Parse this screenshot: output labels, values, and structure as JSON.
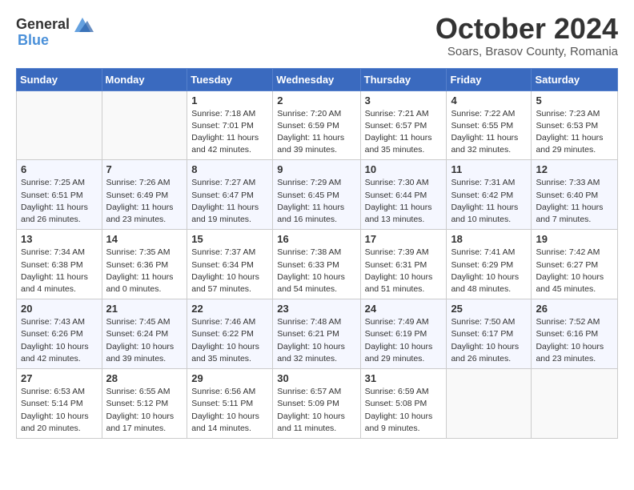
{
  "header": {
    "logo_general": "General",
    "logo_blue": "Blue",
    "month_title": "October 2024",
    "location": "Soars, Brasov County, Romania"
  },
  "weekdays": [
    "Sunday",
    "Monday",
    "Tuesday",
    "Wednesday",
    "Thursday",
    "Friday",
    "Saturday"
  ],
  "weeks": [
    [
      {
        "num": "",
        "detail": ""
      },
      {
        "num": "",
        "detail": ""
      },
      {
        "num": "1",
        "detail": "Sunrise: 7:18 AM\nSunset: 7:01 PM\nDaylight: 11 hours and 42 minutes."
      },
      {
        "num": "2",
        "detail": "Sunrise: 7:20 AM\nSunset: 6:59 PM\nDaylight: 11 hours and 39 minutes."
      },
      {
        "num": "3",
        "detail": "Sunrise: 7:21 AM\nSunset: 6:57 PM\nDaylight: 11 hours and 35 minutes."
      },
      {
        "num": "4",
        "detail": "Sunrise: 7:22 AM\nSunset: 6:55 PM\nDaylight: 11 hours and 32 minutes."
      },
      {
        "num": "5",
        "detail": "Sunrise: 7:23 AM\nSunset: 6:53 PM\nDaylight: 11 hours and 29 minutes."
      }
    ],
    [
      {
        "num": "6",
        "detail": "Sunrise: 7:25 AM\nSunset: 6:51 PM\nDaylight: 11 hours and 26 minutes."
      },
      {
        "num": "7",
        "detail": "Sunrise: 7:26 AM\nSunset: 6:49 PM\nDaylight: 11 hours and 23 minutes."
      },
      {
        "num": "8",
        "detail": "Sunrise: 7:27 AM\nSunset: 6:47 PM\nDaylight: 11 hours and 19 minutes."
      },
      {
        "num": "9",
        "detail": "Sunrise: 7:29 AM\nSunset: 6:45 PM\nDaylight: 11 hours and 16 minutes."
      },
      {
        "num": "10",
        "detail": "Sunrise: 7:30 AM\nSunset: 6:44 PM\nDaylight: 11 hours and 13 minutes."
      },
      {
        "num": "11",
        "detail": "Sunrise: 7:31 AM\nSunset: 6:42 PM\nDaylight: 11 hours and 10 minutes."
      },
      {
        "num": "12",
        "detail": "Sunrise: 7:33 AM\nSunset: 6:40 PM\nDaylight: 11 hours and 7 minutes."
      }
    ],
    [
      {
        "num": "13",
        "detail": "Sunrise: 7:34 AM\nSunset: 6:38 PM\nDaylight: 11 hours and 4 minutes."
      },
      {
        "num": "14",
        "detail": "Sunrise: 7:35 AM\nSunset: 6:36 PM\nDaylight: 11 hours and 0 minutes."
      },
      {
        "num": "15",
        "detail": "Sunrise: 7:37 AM\nSunset: 6:34 PM\nDaylight: 10 hours and 57 minutes."
      },
      {
        "num": "16",
        "detail": "Sunrise: 7:38 AM\nSunset: 6:33 PM\nDaylight: 10 hours and 54 minutes."
      },
      {
        "num": "17",
        "detail": "Sunrise: 7:39 AM\nSunset: 6:31 PM\nDaylight: 10 hours and 51 minutes."
      },
      {
        "num": "18",
        "detail": "Sunrise: 7:41 AM\nSunset: 6:29 PM\nDaylight: 10 hours and 48 minutes."
      },
      {
        "num": "19",
        "detail": "Sunrise: 7:42 AM\nSunset: 6:27 PM\nDaylight: 10 hours and 45 minutes."
      }
    ],
    [
      {
        "num": "20",
        "detail": "Sunrise: 7:43 AM\nSunset: 6:26 PM\nDaylight: 10 hours and 42 minutes."
      },
      {
        "num": "21",
        "detail": "Sunrise: 7:45 AM\nSunset: 6:24 PM\nDaylight: 10 hours and 39 minutes."
      },
      {
        "num": "22",
        "detail": "Sunrise: 7:46 AM\nSunset: 6:22 PM\nDaylight: 10 hours and 35 minutes."
      },
      {
        "num": "23",
        "detail": "Sunrise: 7:48 AM\nSunset: 6:21 PM\nDaylight: 10 hours and 32 minutes."
      },
      {
        "num": "24",
        "detail": "Sunrise: 7:49 AM\nSunset: 6:19 PM\nDaylight: 10 hours and 29 minutes."
      },
      {
        "num": "25",
        "detail": "Sunrise: 7:50 AM\nSunset: 6:17 PM\nDaylight: 10 hours and 26 minutes."
      },
      {
        "num": "26",
        "detail": "Sunrise: 7:52 AM\nSunset: 6:16 PM\nDaylight: 10 hours and 23 minutes."
      }
    ],
    [
      {
        "num": "27",
        "detail": "Sunrise: 6:53 AM\nSunset: 5:14 PM\nDaylight: 10 hours and 20 minutes."
      },
      {
        "num": "28",
        "detail": "Sunrise: 6:55 AM\nSunset: 5:12 PM\nDaylight: 10 hours and 17 minutes."
      },
      {
        "num": "29",
        "detail": "Sunrise: 6:56 AM\nSunset: 5:11 PM\nDaylight: 10 hours and 14 minutes."
      },
      {
        "num": "30",
        "detail": "Sunrise: 6:57 AM\nSunset: 5:09 PM\nDaylight: 10 hours and 11 minutes."
      },
      {
        "num": "31",
        "detail": "Sunrise: 6:59 AM\nSunset: 5:08 PM\nDaylight: 10 hours and 9 minutes."
      },
      {
        "num": "",
        "detail": ""
      },
      {
        "num": "",
        "detail": ""
      }
    ]
  ]
}
